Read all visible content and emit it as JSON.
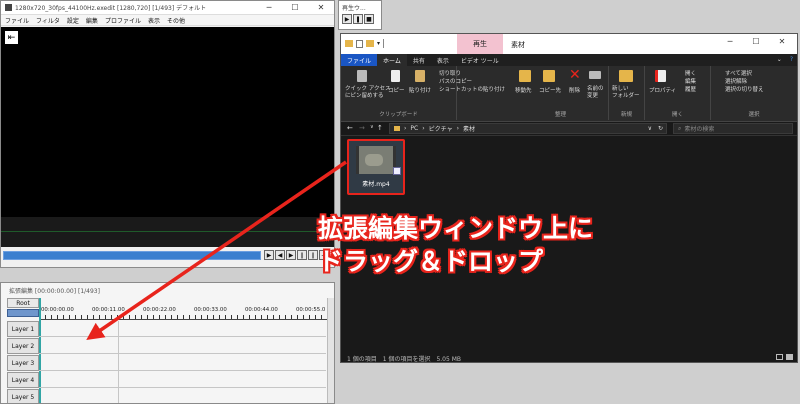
{
  "main_window": {
    "title": "1280x720_30fps_44100Hz.exedit [1280,720] [1/493] デフォルト",
    "menu": [
      "ファイル",
      "フィルタ",
      "設定",
      "編集",
      "プロファイル",
      "表示",
      "その他"
    ]
  },
  "player": {
    "title": "再生ウ..."
  },
  "timeline": {
    "title": "拡張編集 [00:00:00.00] [1/493]",
    "root": "Root",
    "times": [
      "00:00:00.00",
      "00:00:11.00",
      "00:00:22.00",
      "00:00:33.00",
      "00:00:44.00",
      "00:00:55.0"
    ],
    "layers": [
      "Layer 1",
      "Layer 2",
      "Layer 3",
      "Layer 4",
      "Layer 5"
    ]
  },
  "explorer": {
    "context_tab": "再生",
    "folder_title": "素材",
    "tabs": [
      "ファイル",
      "ホーム",
      "共有",
      "表示",
      "ビデオ ツール"
    ],
    "ribbon": {
      "pin": "クイック アクセス\nにピン留めする",
      "copy": "コピー",
      "paste": "貼り付け",
      "cut": "切り取り",
      "copy_path": "パスのコピー",
      "paste_shortcut": "ショートカットの貼り付け",
      "clipboard_group": "クリップボード",
      "move_to": "移動先",
      "copy_to": "コピー先",
      "delete": "削除",
      "rename": "名前の\n変更",
      "organize_group": "整理",
      "new_folder": "新しい\nフォルダー",
      "new_group": "新規",
      "properties": "プロパティ",
      "open": "開く",
      "edit": "編集",
      "history": "履歴",
      "open_group": "開く",
      "select_all": "すべて選択",
      "select_none": "選択解除",
      "invert": "選択の切り替え",
      "select_group": "選択"
    },
    "path": [
      "PC",
      "ピクチャ",
      "素材"
    ],
    "search_placeholder": "素材の検索",
    "file_name": "素材.mp4",
    "status": "1 個の項目　1 個の項目を選択　5.05 MB"
  },
  "overlay": {
    "line1": "拡張編集ウィンドウ上に",
    "line2": "ドラッグ＆ドロップ"
  },
  "colors": {
    "accent": "#e8241c",
    "timebar": "#3b7fcf",
    "explorer_bg": "#191919"
  }
}
